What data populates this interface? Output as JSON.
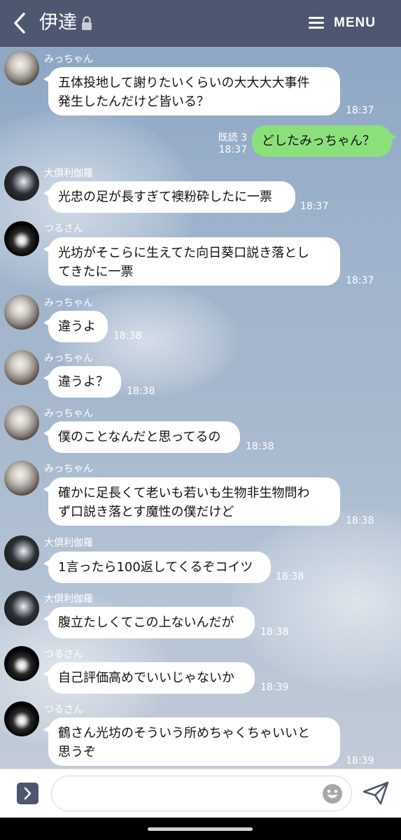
{
  "header": {
    "title": "伊達",
    "menu_label": "MENU"
  },
  "messages": [
    {
      "sender": "みっちゃん",
      "lines": "五体投地して謝りたいくらいの大大大大事件\n発生したんだけど皆いる？",
      "time": "18:37"
    },
    {
      "read": "既読 3",
      "time": "18:37",
      "text": "どしたみっちゃん？"
    },
    {
      "sender": "大倶利伽羅",
      "text": "光忠の足が長すぎて襖粉砕したに一票",
      "time": "18:37"
    },
    {
      "sender": "つるさん",
      "lines": "光坊がそこらに生えてた向日葵口説き落とし\nてきたに一票",
      "time": "18:37"
    },
    {
      "sender": "みっちゃん",
      "text": "違うよ",
      "time": "18:38"
    },
    {
      "sender": "みっちゃん",
      "text": "違うよ？",
      "time": "18:38"
    },
    {
      "sender": "みっちゃん",
      "text": "僕のことなんだと思ってるの",
      "time": "18:38"
    },
    {
      "sender": "みっちゃん",
      "lines": "確かに足長くて老いも若いも生物非生物問わ\nず口説き落とす魔性の僕だけど",
      "time": "18:38"
    },
    {
      "sender": "大倶利伽羅",
      "text": "1言ったら100返してくるぞコイツ",
      "time": "18:38"
    },
    {
      "sender": "大倶利伽羅",
      "text": "腹立たしくてこの上ないんだが",
      "time": "18:38"
    },
    {
      "sender": "つるさん",
      "text": "自己評価高めでいいじゃないか",
      "time": "18:39"
    },
    {
      "sender": "つるさん",
      "lines": "鶴さん光坊のそういう所めちゃくちゃいいと\n思うぞ",
      "time": "18:39"
    }
  ],
  "input": {
    "value": "",
    "placeholder": ""
  },
  "icons": {
    "back": "chevron-left-icon",
    "lock": "lock-icon",
    "menu": "hamburger-icon",
    "expand": "chevron-right-icon",
    "emoji": "smiley-icon",
    "send": "paper-plane-icon"
  },
  "colors": {
    "header": "#4d5770",
    "outgoing_bubble": "#8ce07c",
    "incoming_bubble": "#ffffff"
  }
}
